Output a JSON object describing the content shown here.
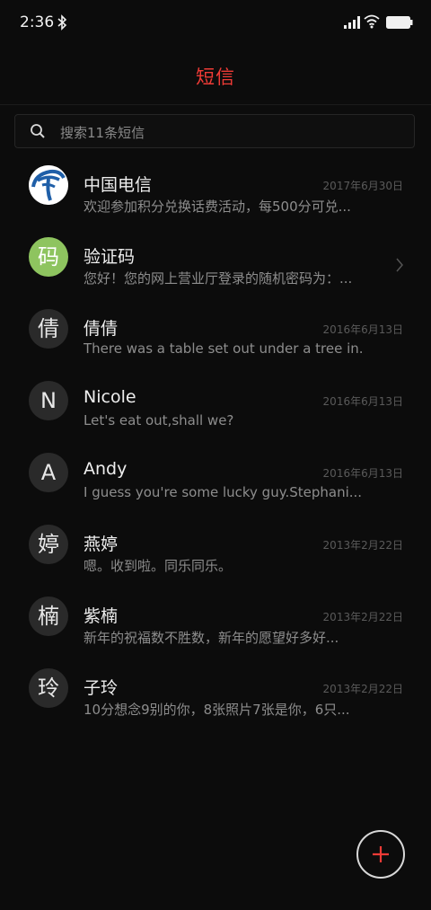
{
  "status_bar": {
    "time": "2:36",
    "icons": [
      "bluetooth-icon",
      "signal-icon",
      "wifi-icon",
      "battery-icon"
    ]
  },
  "header": {
    "title": "短信"
  },
  "search": {
    "placeholder": "搜索11条短信",
    "icon": "search-icon"
  },
  "colors": {
    "accent": "#ef3b36",
    "background": "#0c0c0c",
    "green_avatar": "#8ec45f"
  },
  "conversations": [
    {
      "name": "中国电信",
      "date": "2017年6月30日",
      "preview": "欢迎参加积分兑换话费活动，每500分可兑...",
      "avatar": "china-telecom-logo"
    },
    {
      "name": "验证码",
      "date": "",
      "preview": "您好！您的网上营业厅登录的随机密码为：...",
      "avatar": "码"
    },
    {
      "name": "倩倩",
      "date": "2016年6月13日",
      "preview": "There was a table set out under a tree in...",
      "avatar": "倩"
    },
    {
      "name": "Nicole",
      "date": "2016年6月13日",
      "preview": "Let's eat out,shall we?",
      "avatar": "N"
    },
    {
      "name": "Andy",
      "date": "2016年6月13日",
      "preview": "I guess you're some lucky guy.Stephani...",
      "avatar": "A"
    },
    {
      "name": "燕婷",
      "date": "2013年2月22日",
      "preview": "嗯。收到啦。同乐同乐。",
      "avatar": "婷"
    },
    {
      "name": "紫楠",
      "date": "2013年2月22日",
      "preview": "新年的祝福数不胜数，新年的愿望好多好...",
      "avatar": "楠"
    },
    {
      "name": "子玲",
      "date": "2013年2月22日",
      "preview": "10分想念9别的你，8张照片7张是你，6只...",
      "avatar": "玲"
    }
  ],
  "fab": {
    "icon": "plus-icon"
  }
}
